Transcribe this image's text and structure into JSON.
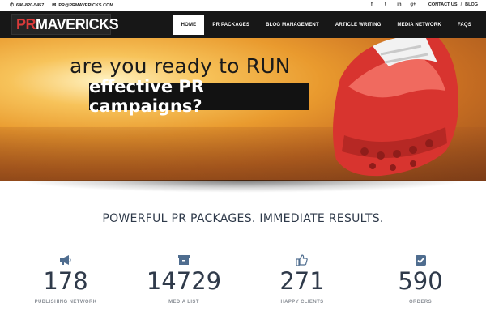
{
  "topbar": {
    "phone": "646-820-5457",
    "email": "PR@PRMAVERICKS.COM",
    "social": [
      {
        "icon": "facebook-icon",
        "glyph": "f"
      },
      {
        "icon": "twitter-icon",
        "glyph": "t"
      },
      {
        "icon": "linkedin-icon",
        "glyph": "in"
      },
      {
        "icon": "googleplus-icon",
        "glyph": "g+"
      }
    ],
    "contact_label": "CONTACT US",
    "separator": "/",
    "blog_label": "BLOG"
  },
  "nav": {
    "logo_pr": "PR",
    "logo_rest": "MAVERICKS",
    "items": [
      "HOME",
      "PR PACKAGES",
      "BLOG MANAGEMENT",
      "ARTICLE WRITING",
      "MEDIA NETWORK",
      "FAQS"
    ],
    "active_index": 0
  },
  "hero": {
    "line1": "are you ready to RUN",
    "line2": "effective PR campaigns?"
  },
  "section": {
    "title": "POWERFUL PR PACKAGES. IMMEDIATE RESULTS."
  },
  "stats": [
    {
      "icon": "megaphone-icon",
      "value": "178",
      "label": "PUBLISHING NETWORK"
    },
    {
      "icon": "archive-box-icon",
      "value": "14729",
      "label": "MEDIA LIST"
    },
    {
      "icon": "thumbs-up-icon",
      "value": "271",
      "label": "HAPPY CLIENTS"
    },
    {
      "icon": "checkbox-icon",
      "value": "590",
      "label": "ORDERS"
    }
  ],
  "colors": {
    "brand_red": "#d93a3a",
    "nav_bg": "#171717",
    "heading": "#2f3a4a",
    "icon_blue": "#4f6d8f"
  }
}
